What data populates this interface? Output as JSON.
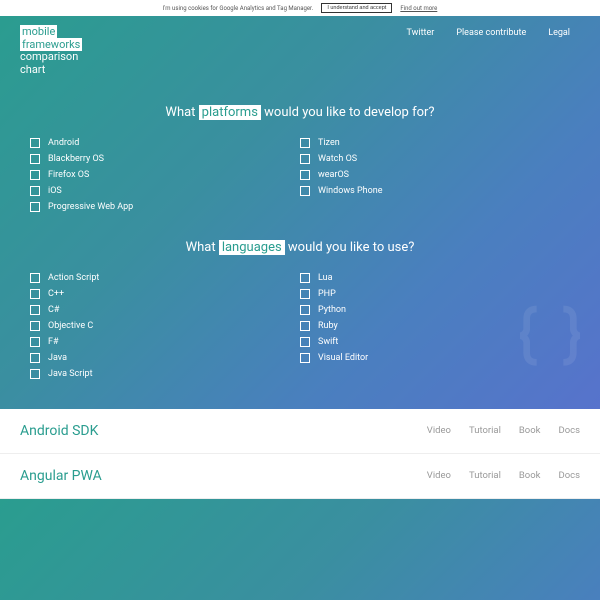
{
  "cookie": {
    "text": "I'm using cookies for Google Analytics and Tag Manager.",
    "accept": "I understand and accept",
    "more": "Find out more"
  },
  "logo": {
    "l1_a": "mobile",
    "l2_a": "frameworks",
    "l3": "comparison",
    "l4": "chart"
  },
  "nav": {
    "twitter": "Twitter",
    "contribute": "Please contribute",
    "legal": "Legal"
  },
  "q_platforms": {
    "pre": "What ",
    "hl": "platforms",
    "post": " would you like to develop for?"
  },
  "platforms_left": [
    {
      "label": "Android"
    },
    {
      "label": "Blackberry OS"
    },
    {
      "label": "Firefox OS"
    },
    {
      "label": "iOS"
    },
    {
      "label": "Progressive Web App"
    }
  ],
  "platforms_right": [
    {
      "label": "Tizen"
    },
    {
      "label": "Watch OS"
    },
    {
      "label": "wearOS"
    },
    {
      "label": "Windows Phone"
    }
  ],
  "q_languages": {
    "pre": "What ",
    "hl": "languages",
    "post": " would you like to use?"
  },
  "languages_left": [
    {
      "label": "Action Script"
    },
    {
      "label": "C++"
    },
    {
      "label": "C#"
    },
    {
      "label": "Objective C"
    },
    {
      "label": "F#"
    },
    {
      "label": "Java"
    },
    {
      "label": "Java Script"
    }
  ],
  "languages_right": [
    {
      "label": "Lua"
    },
    {
      "label": "PHP"
    },
    {
      "label": "Python"
    },
    {
      "label": "Ruby"
    },
    {
      "label": "Swift"
    },
    {
      "label": "Visual Editor"
    }
  ],
  "result_links": {
    "video": "Video",
    "tutorial": "Tutorial",
    "book": "Book",
    "docs": "Docs"
  },
  "results": [
    {
      "name": "Android SDK"
    },
    {
      "name": "Angular PWA"
    }
  ]
}
